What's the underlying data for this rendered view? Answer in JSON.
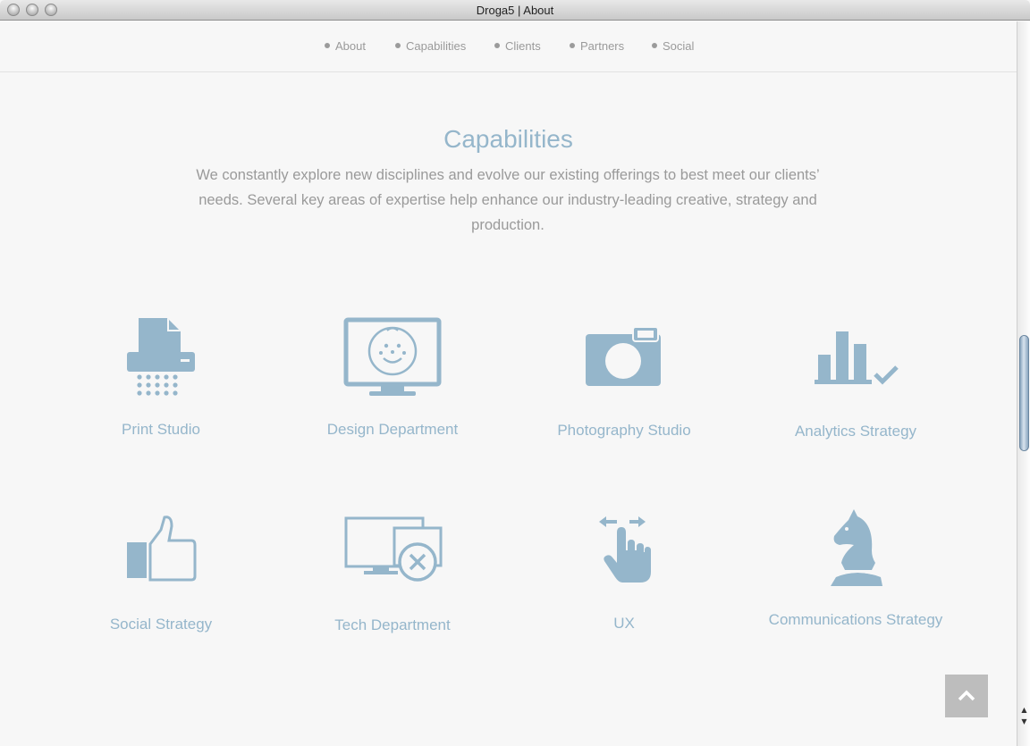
{
  "window": {
    "title": "Droga5 | About"
  },
  "nav": {
    "items": [
      {
        "label": "About"
      },
      {
        "label": "Capabilities"
      },
      {
        "label": "Clients"
      },
      {
        "label": "Partners"
      },
      {
        "label": "Social"
      }
    ]
  },
  "main": {
    "heading": "Capabilities",
    "intro": "We constantly explore new disciplines and evolve our existing offerings to best meet our clients’ needs. Several key areas of expertise help enhance our industry-leading creative, strategy and production.",
    "capabilities": [
      {
        "label": "Print Studio",
        "icon": "paper-shredder-icon"
      },
      {
        "label": "Design Department",
        "icon": "monitor-face-icon"
      },
      {
        "label": "Photography Studio",
        "icon": "camera-icon"
      },
      {
        "label": "Analytics Strategy",
        "icon": "bar-chart-check-icon"
      },
      {
        "label": "Social Strategy",
        "icon": "thumbs-up-icon"
      },
      {
        "label": "Tech Department",
        "icon": "devices-x-icon"
      },
      {
        "label": "UX",
        "icon": "swipe-hand-icon"
      },
      {
        "label": "Communications Strategy",
        "icon": "chess-knight-icon"
      }
    ]
  },
  "back_to_top": {
    "icon": "chevron-up-icon"
  },
  "colors": {
    "accent": "#95b6cb",
    "text": "#9a9a9a",
    "background": "#f7f7f7"
  }
}
